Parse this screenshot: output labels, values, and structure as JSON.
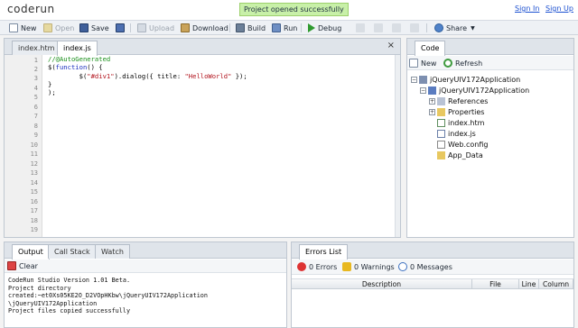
{
  "app": {
    "logo": "coderun",
    "notification": "Project opened successfully",
    "sign_in": "Sign In",
    "sign_up": "Sign Up"
  },
  "toolbar": {
    "new": "New",
    "open": "Open",
    "save": "Save",
    "upload": "Upload",
    "download": "Download",
    "build": "Build",
    "run": "Run",
    "debug": "Debug",
    "share": "Share"
  },
  "editor": {
    "tabs": [
      "index.htm",
      "index.js"
    ],
    "active_tab": "index.js",
    "close": "×",
    "line_numbers": [
      "1",
      "2",
      "3",
      "4",
      "5",
      "6",
      "7",
      "8",
      "9",
      "10",
      "11",
      "12",
      "13",
      "14",
      "15",
      "16",
      "17",
      "18",
      "19"
    ],
    "code": {
      "l1": "//@AutoGenerated",
      "l2a": "$(",
      "l2b": "function",
      "l2c": "() {",
      "l3a": "        $(",
      "l3b": "\"#div1\"",
      "l3c": ").dialog({ title: ",
      "l3d": "\"HelloWorld\"",
      "l3e": " });",
      "l4": "}",
      "l5": ");"
    }
  },
  "code_panel": {
    "tab": "Code",
    "new": "New",
    "refresh": "Refresh",
    "tree": {
      "root": "jQueryUIV172Application",
      "project": "jQueryUIV172Application",
      "references": "References",
      "properties": "Properties",
      "index_htm": "index.htm",
      "index_js": "index.js",
      "web_config": "Web.config",
      "app_data": "App_Data"
    }
  },
  "output_panel": {
    "tabs": [
      "Output",
      "Call Stack",
      "Watch"
    ],
    "clear": "Clear",
    "lines": [
      "CodeRun Studio Version 1.01 Beta.",
      "Project directory",
      "created:~et0Xs05KE2O_D2VOpHKbw\\jQueryUIV172Application",
      "\\jQueryUIV172Application",
      "Project files copied successfully"
    ]
  },
  "errors_panel": {
    "tab": "Errors List",
    "errors": "0 Errors",
    "warnings": "0 Warnings",
    "messages": "0 Messages",
    "columns": [
      "Description",
      "File",
      "Line",
      "Column"
    ]
  },
  "colors": {
    "notice_bg": "#c8f0a8",
    "link": "#1a4fd0",
    "comment": "#1a8f1a",
    "keyword": "#1b2fbf",
    "string": "#b1101a"
  }
}
